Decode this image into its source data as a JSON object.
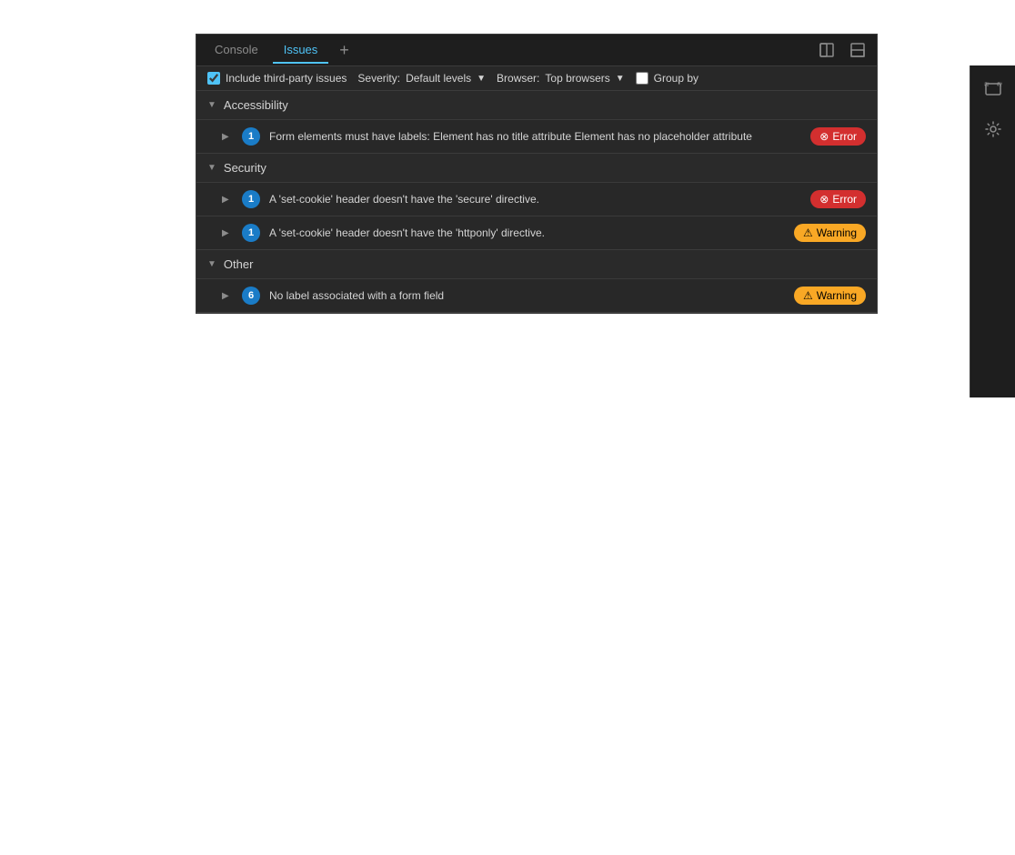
{
  "tabs": [
    {
      "id": "console",
      "label": "Console",
      "active": false
    },
    {
      "id": "issues",
      "label": "Issues",
      "active": true
    }
  ],
  "tab_add_label": "+",
  "toolbar": {
    "include_third_party": {
      "label": "Include third-party issues",
      "checked": true
    },
    "severity": {
      "label": "Severity:",
      "value": "Default levels"
    },
    "browser": {
      "label": "Browser:",
      "value": "Top browsers"
    },
    "group_by": {
      "label": "Group by"
    }
  },
  "categories": [
    {
      "id": "accessibility",
      "label": "Accessibility",
      "expanded": true,
      "issues": [
        {
          "id": "acc-1",
          "count": 1,
          "text": "Form elements must have labels: Element has no title attribute Element has no placeholder attribute",
          "severity": "Error",
          "badge_type": "error"
        }
      ]
    },
    {
      "id": "security",
      "label": "Security",
      "expanded": true,
      "issues": [
        {
          "id": "sec-1",
          "count": 1,
          "text": "A 'set-cookie' header doesn't have the 'secure' directive.",
          "severity": "Error",
          "badge_type": "error"
        },
        {
          "id": "sec-2",
          "count": 1,
          "text": "A 'set-cookie' header doesn't have the 'httponly' directive.",
          "severity": "Warning",
          "badge_type": "warning"
        }
      ]
    },
    {
      "id": "other",
      "label": "Other",
      "expanded": true,
      "issues": [
        {
          "id": "oth-1",
          "count": 6,
          "text": "No label associated with a form field",
          "severity": "Warning",
          "badge_type": "warning"
        }
      ]
    }
  ],
  "icons": {
    "dock_icon": "⊟",
    "undock_icon": "⊞",
    "screenshot_icon": "⊡",
    "settings_icon": "⚙"
  }
}
